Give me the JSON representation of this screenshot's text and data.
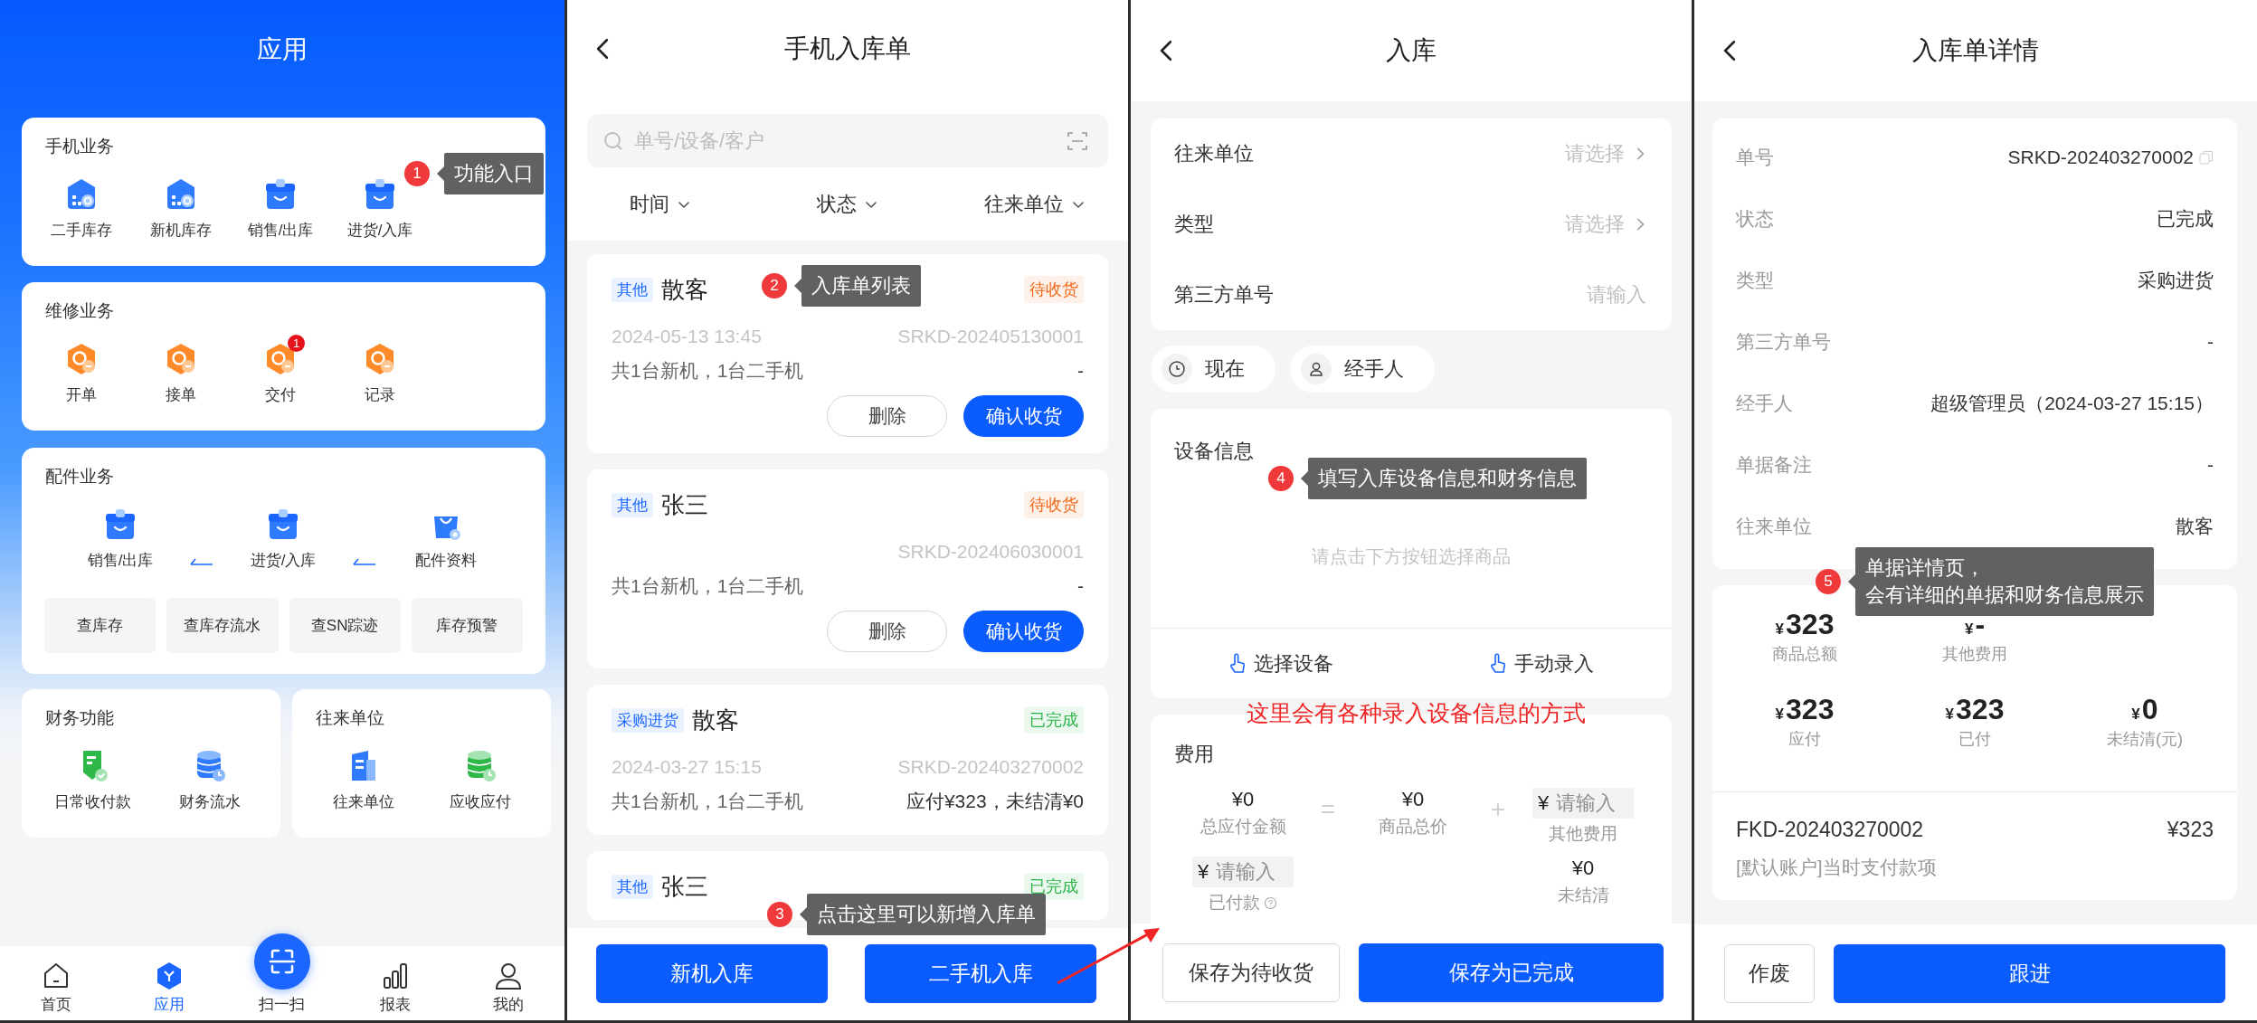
{
  "app_screen": {
    "title": "应用",
    "sections": [
      {
        "kind": "grid",
        "title": "手机业务",
        "items": [
          {
            "label": "二手库存"
          },
          {
            "label": "新机库存"
          },
          {
            "label": "销售/出库"
          },
          {
            "label": "进货/入库"
          }
        ]
      },
      {
        "kind": "grid",
        "title": "维修业务",
        "items": [
          {
            "label": "开单"
          },
          {
            "label": "接单"
          },
          {
            "label": "交付",
            "badge": "1"
          },
          {
            "label": "记录"
          }
        ]
      },
      {
        "kind": "flow",
        "title": "配件业务",
        "items": [
          {
            "label": "销售/出库"
          },
          {
            "label": "进货/入库"
          },
          {
            "label": "配件资料"
          }
        ],
        "links": [
          "查库存",
          "查库存流水",
          "查SN踪迹",
          "库存预警"
        ]
      }
    ],
    "half_sections": [
      {
        "title": "财务功能",
        "items": [
          {
            "label": "日常收付款"
          },
          {
            "label": "财务流水"
          }
        ]
      },
      {
        "title": "往来单位",
        "items": [
          {
            "label": "往来单位"
          },
          {
            "label": "应收应付"
          }
        ]
      }
    ],
    "tab_bar": [
      {
        "kind": "tab",
        "label": "首页",
        "selected": false
      },
      {
        "kind": "tab",
        "label": "应用",
        "selected": true
      },
      {
        "kind": "scan",
        "label": "扫一扫",
        "selected": false
      },
      {
        "kind": "tab",
        "label": "报表",
        "selected": false
      },
      {
        "kind": "tab",
        "label": "我的",
        "selected": false
      }
    ]
  },
  "list_screen": {
    "title": "手机入库单",
    "search": {
      "placeholder": "单号/设备/客户"
    },
    "filters": [
      "时间",
      "状态",
      "往来单位"
    ],
    "orders": [
      {
        "tag": "其他",
        "name": "散客",
        "status": "待收货",
        "color": "#f26a1b",
        "date": "2024-05-13 13:45",
        "number": "SRKD-202405130001",
        "summary": "共1台新机，1台二手机",
        "amount": "-",
        "actions": [
          "删除",
          "确认收货"
        ]
      },
      {
        "tag": "其他",
        "name": "张三",
        "status": "待收货",
        "color": "#f26a1b",
        "number": "SRKD-202406030001",
        "summary": "共1台新机，1台二手机",
        "amount": "-",
        "actions": [
          "删除",
          "确认收货"
        ]
      },
      {
        "tag": "采购进货",
        "name": "散客",
        "status": "已完成",
        "color": "#2bb34a",
        "date": "2024-03-27 15:15",
        "number": "SRKD-202403270002",
        "summary": "共1台新机，1台二手机",
        "amount": "应付¥323，未结清¥0"
      },
      {
        "tag": "其他",
        "name": "张三",
        "status": "已完成",
        "color": "#2bb34a"
      }
    ],
    "buttons": [
      "新机入库",
      "二手机入库"
    ]
  },
  "entry_screen": {
    "title": "入库",
    "fields": [
      {
        "kind": "select",
        "label": "往来单位",
        "placeholder": "请选择"
      },
      {
        "kind": "select",
        "label": "类型",
        "placeholder": "请选择"
      },
      {
        "kind": "input",
        "label": "第三方单号",
        "placeholder": "请输入"
      }
    ],
    "chips": [
      "现在",
      "经手人"
    ],
    "device": {
      "title": "设备信息",
      "hint": "请点击下方按钮选择商品",
      "actions": [
        "选择设备",
        "手动录入"
      ]
    },
    "cost": {
      "title": "费用",
      "total": {
        "value": "¥0",
        "label": "总应付金额"
      },
      "equals": "=",
      "goods": {
        "value": "¥0",
        "label": "商品总价"
      },
      "plus": "+",
      "other": {
        "currency": "¥",
        "placeholder": "请输入",
        "label": "其他费用"
      },
      "paid": {
        "currency": "¥",
        "placeholder": "请输入",
        "label": "已付款"
      },
      "unsettled": {
        "value": "¥0",
        "label": "未结清"
      }
    },
    "buttons": [
      "保存为待收货",
      "保存为已完成"
    ]
  },
  "detail_screen": {
    "title": "入库单详情",
    "rows": [
      {
        "kind": "copy",
        "label": "单号",
        "value": "SRKD-202403270002"
      },
      {
        "kind": "text",
        "label": "状态",
        "value": "已完成"
      },
      {
        "kind": "text",
        "label": "类型",
        "value": "采购进货"
      },
      {
        "kind": "text",
        "label": "第三方单号",
        "value": "-"
      },
      {
        "kind": "text",
        "label": "经手人",
        "value": "超级管理员（2024-03-27 15:15）"
      },
      {
        "kind": "text",
        "label": "单据备注",
        "value": "-"
      },
      {
        "kind": "text",
        "label": "往来单位",
        "value": "散客"
      }
    ],
    "totals": [
      [
        {
          "currency": "¥",
          "amount": "323",
          "label": "商品总额"
        },
        {
          "currency": "¥",
          "amount": "-",
          "label": "其他费用"
        }
      ],
      [
        {
          "currency": "¥",
          "amount": "323",
          "label": "应付"
        },
        {
          "currency": "¥",
          "amount": "323",
          "label": "已付"
        },
        {
          "currency": "¥",
          "amount": "0",
          "label": "未结清(元)"
        }
      ]
    ],
    "payment": {
      "number": "FKD-202403270002",
      "amount": "¥323",
      "note": "[默认账户]当时支付款项"
    },
    "buttons": [
      "作废",
      "跟进"
    ]
  },
  "annotations": [
    {
      "number": "1",
      "lines": [
        "功能入口"
      ]
    },
    {
      "number": "2",
      "lines": [
        "入库单列表"
      ]
    },
    {
      "number": "3",
      "lines": [
        "点击这里可以新增入库单"
      ]
    },
    {
      "number": "4",
      "lines": [
        "填写入库设备信息和财务信息"
      ]
    },
    {
      "number": "5",
      "lines": [
        "单据详情页，",
        "会有详细的单据和财务信息展示"
      ]
    }
  ],
  "callout": "这里会有各种录入设备信息的方式"
}
